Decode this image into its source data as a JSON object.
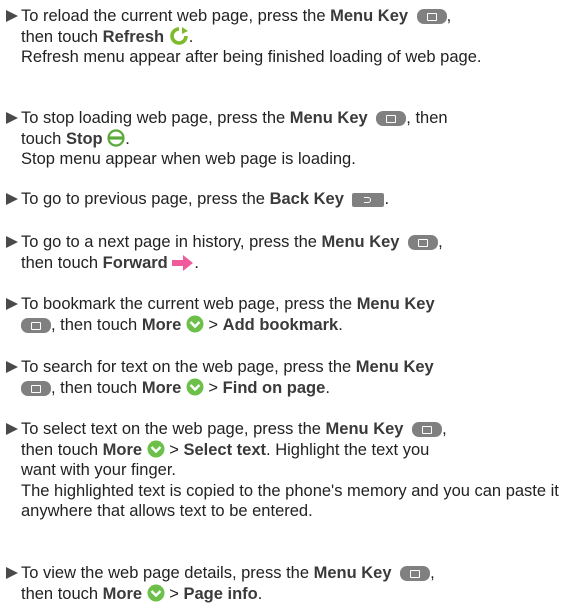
{
  "items": [
    {
      "line1a": "To reload the current web page, press the ",
      "line1b": "Menu Key",
      "line1c": ",",
      "line2a": "then touch ",
      "line2b": "Refresh",
      "note": "Refresh menu appear after being finished loading of web page."
    },
    {
      "line1a": "To stop loading web page, press the ",
      "line1b": "Menu Key",
      "line1c": ", then",
      "line2a": "touch ",
      "line2b": "Stop",
      "note": "Stop menu appear when web page is loading."
    },
    {
      "a": "To go to previous page, press the ",
      "b": "Back Key",
      "c": "."
    },
    {
      "line1a": "To go to a next page in history, press the ",
      "line1b": "Menu Key",
      "line1c": ",",
      "line2a": "then touch ",
      "line2b": "Forward",
      "line2c": "."
    },
    {
      "line1a": "To bookmark the current web page, press the ",
      "line1b": "Menu Key",
      "line2a": ", then touch ",
      "line2b": "More",
      "line2c": " > ",
      "line2d": "Add bookmark",
      "line2e": "."
    },
    {
      "line1a": "To search for text on the web page, press the ",
      "line1b": "Menu Key",
      "line2a": ", then touch ",
      "line2b": "More",
      "line2c": " > ",
      "line2d": "Find on page",
      "line2e": "."
    },
    {
      "line1a": "To select text on the web page, press the ",
      "line1b": "Menu Key",
      "line1c": ",",
      "line2a": "then touch ",
      "line2b": "More",
      "line2c": " > ",
      "line2d": "Select text",
      "line2e": ". Highlight the text you",
      "line3": "want with your finger.",
      "note": "The highlighted text is copied to the phone's memory and you can paste it anywhere that allows text to be entered."
    },
    {
      "line1a": "To view the web page details, press the ",
      "line1b": "Menu Key",
      "line1c": ",",
      "line2a": "then touch ",
      "line2b": "More",
      "line2c": " > ",
      "line2d": "Page info",
      "line2e": "."
    }
  ],
  "icons": {
    "menu_key": "menu-key-icon",
    "back_key": "back-key-icon",
    "refresh": "refresh-icon",
    "stop": "stop-icon",
    "forward": "forward-arrow-icon",
    "more": "more-chevron-icon"
  },
  "colors": {
    "text": "#222222",
    "bold": "#3a3a3a",
    "key_gray": "#808080",
    "refresh_green": "#7dbb2a",
    "stop_green": "#5aaa3a",
    "forward_pink": "#f15a9a",
    "more_green": "#6cc04a"
  }
}
